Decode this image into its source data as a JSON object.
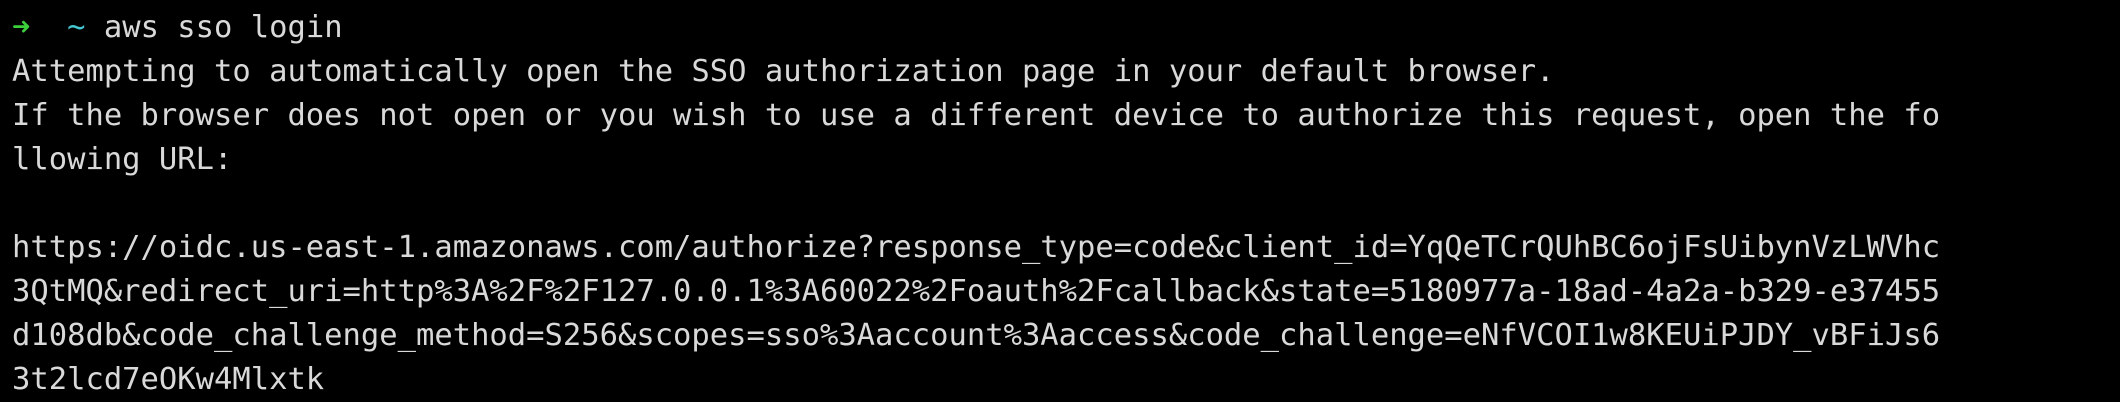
{
  "terminal": {
    "prompt": {
      "arrow": "➜",
      "directory": "~",
      "command": "aws sso login"
    },
    "output": {
      "line_1": "Attempting to automatically open the SSO authorization page in your default browser.",
      "line_2": "If the browser does not open or you wish to use a different device to authorize this request, open the fo",
      "line_3": "llowing URL:",
      "line_4": "",
      "url_line_1": "https://oidc.us-east-1.amazonaws.com/authorize?response_type=code&client_id=YqQeTCrQUhBC6ojFsUibynVzLWVhc",
      "url_line_2": "3QtMQ&redirect_uri=http%3A%2F%2F127.0.0.1%3A60022%2Foauth%2Fcallback&state=5180977a-18ad-4a2a-b329-e37455",
      "url_line_3": "d108db&code_challenge_method=S256&scopes=sso%3Aaccount%3Aaccess&code_challenge=eNfVCOI1w8KEUiPJDY_vBFiJs6",
      "url_line_4": "3t2lcd7eOKw4Mlxtk"
    },
    "colors": {
      "background": "#000000",
      "text": "#d9d9d9",
      "prompt_arrow": "#3ccf3c",
      "prompt_directory": "#43c7d0"
    }
  }
}
